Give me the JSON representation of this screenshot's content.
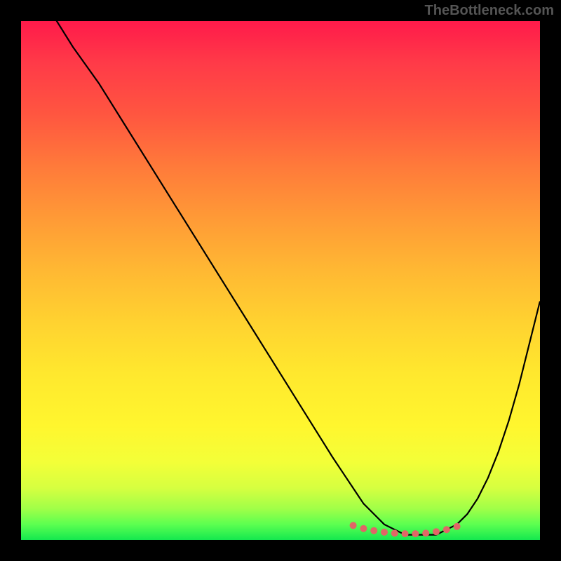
{
  "watermark": "TheBottleneck.com",
  "chart_data": {
    "type": "line",
    "title": "",
    "xlabel": "",
    "ylabel": "",
    "xlim": [
      0,
      100
    ],
    "ylim": [
      0,
      100
    ],
    "series": [
      {
        "name": "bottleneck-curve",
        "x": [
          0,
          5,
          10,
          15,
          20,
          25,
          30,
          35,
          40,
          45,
          50,
          55,
          60,
          62,
          64,
          66,
          68,
          70,
          72,
          74,
          76,
          78,
          80,
          82,
          84,
          86,
          88,
          90,
          92,
          94,
          96,
          98,
          100
        ],
        "y": [
          110,
          103,
          95,
          88,
          80,
          72,
          64,
          56,
          48,
          40,
          32,
          24,
          16,
          13,
          10,
          7,
          5,
          3,
          2,
          1,
          1,
          1,
          1,
          2,
          3,
          5,
          8,
          12,
          17,
          23,
          30,
          38,
          46
        ]
      }
    ],
    "highlight_points": {
      "name": "optimal-range",
      "color": "#e06666",
      "x": [
        64,
        66,
        68,
        70,
        72,
        74,
        76,
        78,
        80,
        82,
        84
      ],
      "y": [
        2.8,
        2.2,
        1.8,
        1.5,
        1.3,
        1.2,
        1.2,
        1.3,
        1.6,
        2.0,
        2.6
      ]
    },
    "background_gradient": {
      "top": "#ff1a4a",
      "middle": "#ffe82e",
      "bottom": "#14e84f"
    }
  }
}
